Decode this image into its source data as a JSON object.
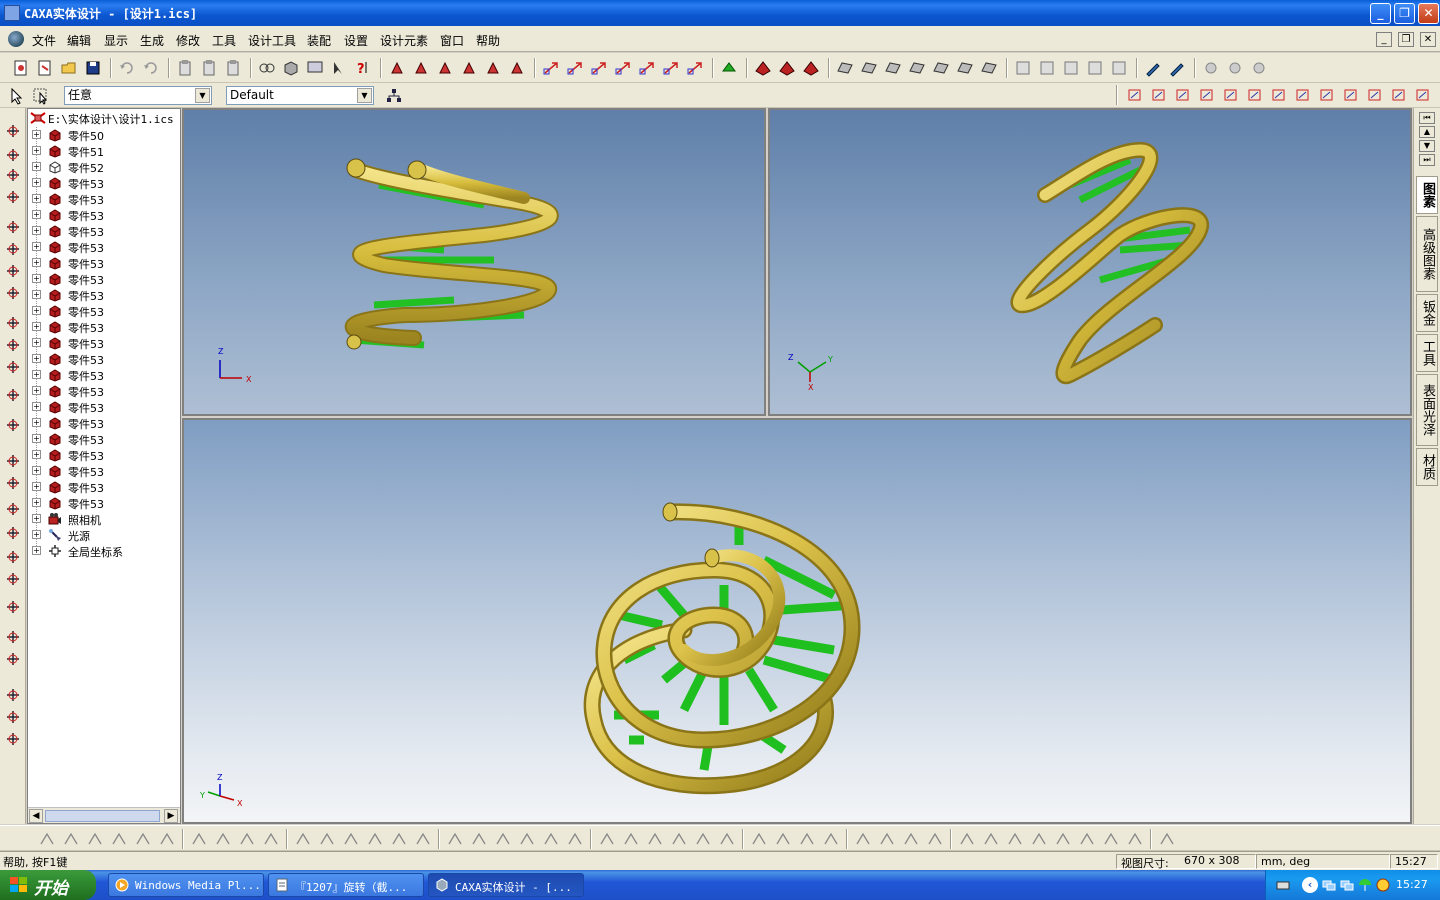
{
  "window": {
    "title": "CAXA实体设计 - [设计1.ics]",
    "controls": {
      "minimize": "_",
      "restore": "❐",
      "close": "✕"
    }
  },
  "menu": {
    "items": [
      "文件",
      "编辑",
      "显示",
      "生成",
      "修改",
      "工具",
      "设计工具",
      "装配",
      "设置",
      "设计元素",
      "窗口",
      "帮助"
    ],
    "mdi": {
      "minimize": "_",
      "restore": "❐",
      "close": "✕"
    }
  },
  "toolbar2": {
    "select_combo": "任意",
    "style_combo": "Default"
  },
  "tree": {
    "root": "E:\\实体设计\\设计1.ics",
    "items": [
      {
        "label": "零件50",
        "icon": "part-icon"
      },
      {
        "label": "零件51",
        "icon": "part-icon"
      },
      {
        "label": "零件52",
        "icon": "part-outline-icon"
      },
      {
        "label": "零件53",
        "icon": "part-icon"
      },
      {
        "label": "零件53",
        "icon": "part-icon"
      },
      {
        "label": "零件53",
        "icon": "part-icon"
      },
      {
        "label": "零件53",
        "icon": "part-icon"
      },
      {
        "label": "零件53",
        "icon": "part-icon"
      },
      {
        "label": "零件53",
        "icon": "part-icon"
      },
      {
        "label": "零件53",
        "icon": "part-icon"
      },
      {
        "label": "零件53",
        "icon": "part-icon"
      },
      {
        "label": "零件53",
        "icon": "part-icon"
      },
      {
        "label": "零件53",
        "icon": "part-icon"
      },
      {
        "label": "零件53",
        "icon": "part-icon"
      },
      {
        "label": "零件53",
        "icon": "part-icon"
      },
      {
        "label": "零件53",
        "icon": "part-icon"
      },
      {
        "label": "零件53",
        "icon": "part-icon"
      },
      {
        "label": "零件53",
        "icon": "part-icon"
      },
      {
        "label": "零件53",
        "icon": "part-icon"
      },
      {
        "label": "零件53",
        "icon": "part-icon"
      },
      {
        "label": "零件53",
        "icon": "part-icon"
      },
      {
        "label": "零件53",
        "icon": "part-icon"
      },
      {
        "label": "零件53",
        "icon": "part-icon"
      },
      {
        "label": "零件53",
        "icon": "part-icon"
      },
      {
        "label": "照相机",
        "icon": "camera-icon"
      },
      {
        "label": "光源",
        "icon": "light-icon"
      },
      {
        "label": "全局坐标系",
        "icon": "coordinate-system-icon"
      }
    ]
  },
  "right_tabs": [
    "图素",
    "高级图素",
    "钣金",
    "工具",
    "表面光泽",
    "材质"
  ],
  "status": {
    "help": "帮助, 按F1键",
    "view_size_label": "视图尺寸:",
    "view_size": "670 x   308",
    "units": "mm, deg",
    "time": "15:27"
  },
  "taskbar": {
    "start": "开始",
    "tasks": [
      {
        "label": "Windows Media Pl...",
        "active": false
      },
      {
        "label": "『1207』旋转（截...",
        "active": false
      },
      {
        "label": "CAXA实体设计 - [...",
        "active": true
      }
    ],
    "clock": "15:27"
  },
  "axes": {
    "x": "X",
    "y": "Y",
    "z": "Z"
  },
  "colors": {
    "helix_gold": "#d9c24a",
    "spoke_green": "#1fbf1f",
    "titlebar_blue": "#0a56d0",
    "part_red": "#b41e1e"
  }
}
